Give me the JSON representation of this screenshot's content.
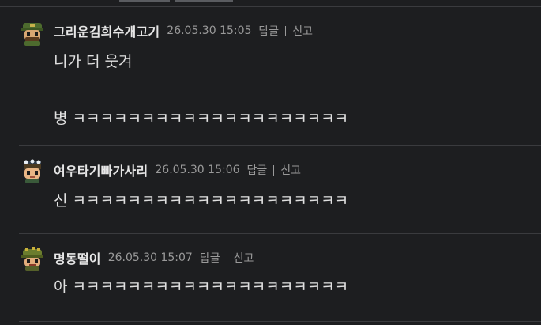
{
  "comments": [
    {
      "nickname": "그리운김희수개고기",
      "datetime": "26.05.30 15:05",
      "reply_label": "답글",
      "report_label": "신고",
      "lines": [
        "니가 더 웃겨",
        "병 ㅋㅋㅋㅋㅋㅋㅋㅋㅋㅋㅋㅋㅋㅋㅋㅋㅋㅋㅋㅋ"
      ],
      "avatar_icon": "soldier-avatar-icon"
    },
    {
      "nickname": "여우타기빠가사리",
      "datetime": "26.05.30 15:06",
      "reply_label": "답글",
      "report_label": "신고",
      "lines": [
        "신 ㅋㅋㅋㅋㅋㅋㅋㅋㅋㅋㅋㅋㅋㅋㅋㅋㅋㅋㅋㅋ"
      ],
      "avatar_icon": "crown-girl-avatar-icon"
    },
    {
      "nickname": "명동떨이",
      "datetime": "26.05.30 15:07",
      "reply_label": "답글",
      "report_label": "신고",
      "lines": [
        "아 ㅋㅋㅋㅋㅋㅋㅋㅋㅋㅋㅋㅋㅋㅋㅋㅋㅋㅋㅋㅋ"
      ],
      "avatar_icon": "helmet-avatar-icon"
    }
  ],
  "colors": {
    "background": "#1d1e20",
    "divider": "#3a3b3e",
    "meta_text": "#9a9a9a",
    "body_text": "#e0e0e0"
  }
}
